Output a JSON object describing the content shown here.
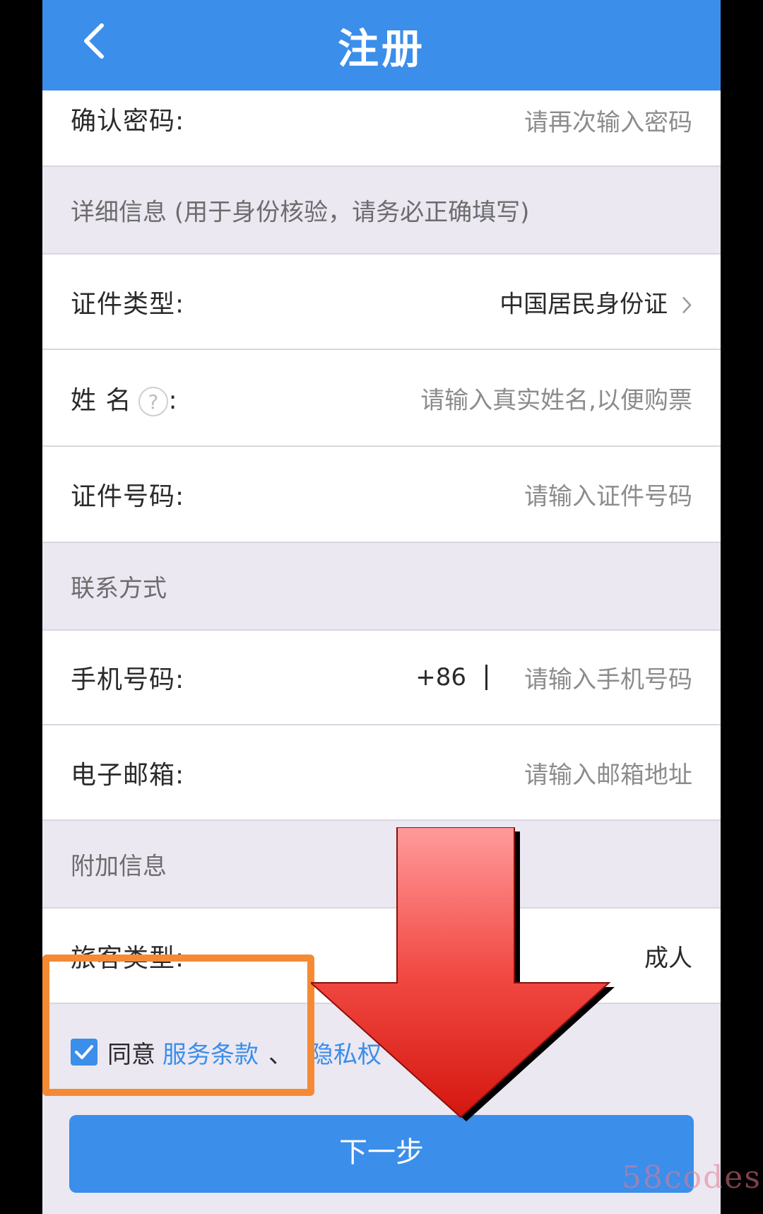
{
  "header": {
    "title": "注册"
  },
  "confirm_password": {
    "label": "确认密码:",
    "placeholder": "请再次输入密码"
  },
  "section_details": "详细信息 (用于身份核验，请务必正确填写)",
  "id_type": {
    "label": "证件类型:",
    "value": "中国居民身份证"
  },
  "name": {
    "label_a": "姓 名",
    "help": "?",
    "colon": ":",
    "placeholder": "请输入真实姓名,以便购票"
  },
  "id_number": {
    "label": "证件号码:",
    "placeholder": "请输入证件号码"
  },
  "section_contact": "联系方式",
  "phone": {
    "label": "手机号码:",
    "prefix": "+86",
    "placeholder": "请输入手机号码"
  },
  "email": {
    "label": "电子邮箱:",
    "placeholder": "请输入邮箱地址"
  },
  "section_extra": "附加信息",
  "passenger_type": {
    "label": "旅客类型:",
    "value": "成人"
  },
  "agree": {
    "prefix": "同意",
    "terms": "服务条款",
    "sep": "、",
    "privacy": "隐私权"
  },
  "next_button": "下一步",
  "watermark": "58codes",
  "colors": {
    "accent": "#3b8eea",
    "highlight": "#f58a35",
    "arrow": "#e8231c"
  }
}
